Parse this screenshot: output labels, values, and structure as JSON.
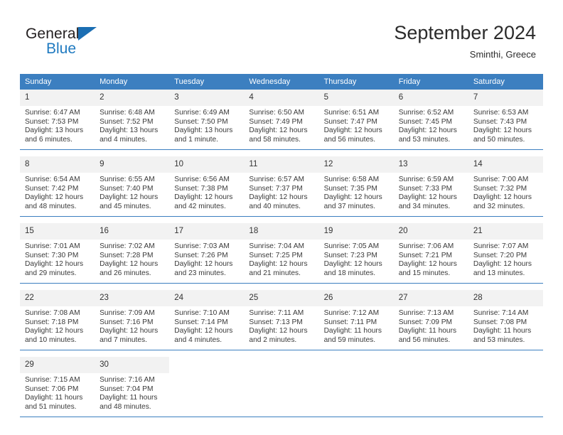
{
  "brand": {
    "name_part1": "General",
    "name_part2": "Blue",
    "triangle_color": "#1b6eb3",
    "text_color": "#231f20",
    "accent_color": "#1f7ac0"
  },
  "header": {
    "title": "September 2024",
    "subtitle": "Sminthi, Greece"
  },
  "theme": {
    "header_bg": "#3c7fc0",
    "header_text": "#ffffff",
    "daynum_bg": "#f2f2f2",
    "row_divider": "#3c7fc0"
  },
  "weekdays": [
    "Sunday",
    "Monday",
    "Tuesday",
    "Wednesday",
    "Thursday",
    "Friday",
    "Saturday"
  ],
  "weeks": [
    [
      {
        "day": "1",
        "sunrise": "Sunrise: 6:47 AM",
        "sunset": "Sunset: 7:53 PM",
        "daylight1": "Daylight: 13 hours",
        "daylight2": "and 6 minutes."
      },
      {
        "day": "2",
        "sunrise": "Sunrise: 6:48 AM",
        "sunset": "Sunset: 7:52 PM",
        "daylight1": "Daylight: 13 hours",
        "daylight2": "and 4 minutes."
      },
      {
        "day": "3",
        "sunrise": "Sunrise: 6:49 AM",
        "sunset": "Sunset: 7:50 PM",
        "daylight1": "Daylight: 13 hours",
        "daylight2": "and 1 minute."
      },
      {
        "day": "4",
        "sunrise": "Sunrise: 6:50 AM",
        "sunset": "Sunset: 7:49 PM",
        "daylight1": "Daylight: 12 hours",
        "daylight2": "and 58 minutes."
      },
      {
        "day": "5",
        "sunrise": "Sunrise: 6:51 AM",
        "sunset": "Sunset: 7:47 PM",
        "daylight1": "Daylight: 12 hours",
        "daylight2": "and 56 minutes."
      },
      {
        "day": "6",
        "sunrise": "Sunrise: 6:52 AM",
        "sunset": "Sunset: 7:45 PM",
        "daylight1": "Daylight: 12 hours",
        "daylight2": "and 53 minutes."
      },
      {
        "day": "7",
        "sunrise": "Sunrise: 6:53 AM",
        "sunset": "Sunset: 7:43 PM",
        "daylight1": "Daylight: 12 hours",
        "daylight2": "and 50 minutes."
      }
    ],
    [
      {
        "day": "8",
        "sunrise": "Sunrise: 6:54 AM",
        "sunset": "Sunset: 7:42 PM",
        "daylight1": "Daylight: 12 hours",
        "daylight2": "and 48 minutes."
      },
      {
        "day": "9",
        "sunrise": "Sunrise: 6:55 AM",
        "sunset": "Sunset: 7:40 PM",
        "daylight1": "Daylight: 12 hours",
        "daylight2": "and 45 minutes."
      },
      {
        "day": "10",
        "sunrise": "Sunrise: 6:56 AM",
        "sunset": "Sunset: 7:38 PM",
        "daylight1": "Daylight: 12 hours",
        "daylight2": "and 42 minutes."
      },
      {
        "day": "11",
        "sunrise": "Sunrise: 6:57 AM",
        "sunset": "Sunset: 7:37 PM",
        "daylight1": "Daylight: 12 hours",
        "daylight2": "and 40 minutes."
      },
      {
        "day": "12",
        "sunrise": "Sunrise: 6:58 AM",
        "sunset": "Sunset: 7:35 PM",
        "daylight1": "Daylight: 12 hours",
        "daylight2": "and 37 minutes."
      },
      {
        "day": "13",
        "sunrise": "Sunrise: 6:59 AM",
        "sunset": "Sunset: 7:33 PM",
        "daylight1": "Daylight: 12 hours",
        "daylight2": "and 34 minutes."
      },
      {
        "day": "14",
        "sunrise": "Sunrise: 7:00 AM",
        "sunset": "Sunset: 7:32 PM",
        "daylight1": "Daylight: 12 hours",
        "daylight2": "and 32 minutes."
      }
    ],
    [
      {
        "day": "15",
        "sunrise": "Sunrise: 7:01 AM",
        "sunset": "Sunset: 7:30 PM",
        "daylight1": "Daylight: 12 hours",
        "daylight2": "and 29 minutes."
      },
      {
        "day": "16",
        "sunrise": "Sunrise: 7:02 AM",
        "sunset": "Sunset: 7:28 PM",
        "daylight1": "Daylight: 12 hours",
        "daylight2": "and 26 minutes."
      },
      {
        "day": "17",
        "sunrise": "Sunrise: 7:03 AM",
        "sunset": "Sunset: 7:26 PM",
        "daylight1": "Daylight: 12 hours",
        "daylight2": "and 23 minutes."
      },
      {
        "day": "18",
        "sunrise": "Sunrise: 7:04 AM",
        "sunset": "Sunset: 7:25 PM",
        "daylight1": "Daylight: 12 hours",
        "daylight2": "and 21 minutes."
      },
      {
        "day": "19",
        "sunrise": "Sunrise: 7:05 AM",
        "sunset": "Sunset: 7:23 PM",
        "daylight1": "Daylight: 12 hours",
        "daylight2": "and 18 minutes."
      },
      {
        "day": "20",
        "sunrise": "Sunrise: 7:06 AM",
        "sunset": "Sunset: 7:21 PM",
        "daylight1": "Daylight: 12 hours",
        "daylight2": "and 15 minutes."
      },
      {
        "day": "21",
        "sunrise": "Sunrise: 7:07 AM",
        "sunset": "Sunset: 7:20 PM",
        "daylight1": "Daylight: 12 hours",
        "daylight2": "and 13 minutes."
      }
    ],
    [
      {
        "day": "22",
        "sunrise": "Sunrise: 7:08 AM",
        "sunset": "Sunset: 7:18 PM",
        "daylight1": "Daylight: 12 hours",
        "daylight2": "and 10 minutes."
      },
      {
        "day": "23",
        "sunrise": "Sunrise: 7:09 AM",
        "sunset": "Sunset: 7:16 PM",
        "daylight1": "Daylight: 12 hours",
        "daylight2": "and 7 minutes."
      },
      {
        "day": "24",
        "sunrise": "Sunrise: 7:10 AM",
        "sunset": "Sunset: 7:14 PM",
        "daylight1": "Daylight: 12 hours",
        "daylight2": "and 4 minutes."
      },
      {
        "day": "25",
        "sunrise": "Sunrise: 7:11 AM",
        "sunset": "Sunset: 7:13 PM",
        "daylight1": "Daylight: 12 hours",
        "daylight2": "and 2 minutes."
      },
      {
        "day": "26",
        "sunrise": "Sunrise: 7:12 AM",
        "sunset": "Sunset: 7:11 PM",
        "daylight1": "Daylight: 11 hours",
        "daylight2": "and 59 minutes."
      },
      {
        "day": "27",
        "sunrise": "Sunrise: 7:13 AM",
        "sunset": "Sunset: 7:09 PM",
        "daylight1": "Daylight: 11 hours",
        "daylight2": "and 56 minutes."
      },
      {
        "day": "28",
        "sunrise": "Sunrise: 7:14 AM",
        "sunset": "Sunset: 7:08 PM",
        "daylight1": "Daylight: 11 hours",
        "daylight2": "and 53 minutes."
      }
    ],
    [
      {
        "day": "29",
        "sunrise": "Sunrise: 7:15 AM",
        "sunset": "Sunset: 7:06 PM",
        "daylight1": "Daylight: 11 hours",
        "daylight2": "and 51 minutes."
      },
      {
        "day": "30",
        "sunrise": "Sunrise: 7:16 AM",
        "sunset": "Sunset: 7:04 PM",
        "daylight1": "Daylight: 11 hours",
        "daylight2": "and 48 minutes."
      },
      {
        "day": "",
        "sunrise": "",
        "sunset": "",
        "daylight1": "",
        "daylight2": ""
      },
      {
        "day": "",
        "sunrise": "",
        "sunset": "",
        "daylight1": "",
        "daylight2": ""
      },
      {
        "day": "",
        "sunrise": "",
        "sunset": "",
        "daylight1": "",
        "daylight2": ""
      },
      {
        "day": "",
        "sunrise": "",
        "sunset": "",
        "daylight1": "",
        "daylight2": ""
      },
      {
        "day": "",
        "sunrise": "",
        "sunset": "",
        "daylight1": "",
        "daylight2": ""
      }
    ]
  ]
}
